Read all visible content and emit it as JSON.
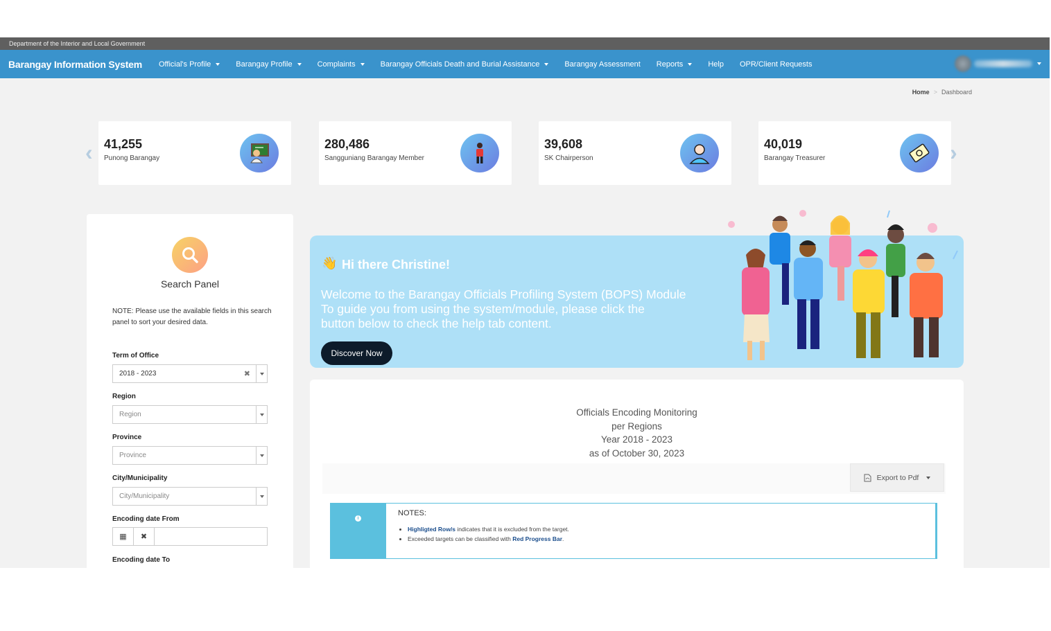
{
  "topstrip": {
    "text": "Department of the Interior and Local Government"
  },
  "nav": {
    "brand": "Barangay Information System",
    "items": [
      {
        "label": "Official's Profile",
        "dropdown": true
      },
      {
        "label": "Barangay Profile",
        "dropdown": true
      },
      {
        "label": "Complaints",
        "dropdown": true
      },
      {
        "label": "Barangay Officials Death and Burial Assistance",
        "dropdown": true
      },
      {
        "label": "Barangay Assessment",
        "dropdown": false
      },
      {
        "label": "Reports",
        "dropdown": true
      },
      {
        "label": "Help",
        "dropdown": false
      },
      {
        "label": "OPR/Client Requests",
        "dropdown": false
      }
    ]
  },
  "breadcrumb": {
    "home": "Home",
    "current": "Dashboard"
  },
  "stats": [
    {
      "value": "41,255",
      "label": "Punong Barangay",
      "icon": "teacher-icon"
    },
    {
      "value": "280,486",
      "label": "Sangguniang Barangay Member",
      "icon": "person-standing-icon"
    },
    {
      "value": "39,608",
      "label": "SK Chairperson",
      "icon": "user-icon"
    },
    {
      "value": "40,019",
      "label": "Barangay Treasurer",
      "icon": "money-icon"
    }
  ],
  "search": {
    "title": "Search Panel",
    "note": "NOTE: Please use the available fields in this search panel to sort your desired data.",
    "term_label": "Term of Office",
    "term_value": "2018 - 2023",
    "region_label": "Region",
    "region_placeholder": "Region",
    "province_label": "Province",
    "province_placeholder": "Province",
    "city_label": "City/Municipality",
    "city_placeholder": "City/Municipality",
    "date_from_label": "Encoding date From",
    "date_to_label": "Encoding date To"
  },
  "banner": {
    "greeting": "Hi there Christine!",
    "line1": "Welcome to the Barangay Officials Profiling System (BOPS) Module",
    "line2": "To guide you from using the system/module, please click the",
    "line3": "button below to check the help tab content.",
    "button": "Discover Now"
  },
  "monitoring": {
    "title1": "Officials Encoding Monitoring",
    "title2": "per Regions",
    "year": "Year 2018 - 2023",
    "asof": "as of October 30, 2023",
    "export_label": "Export to Pdf",
    "notes_head": "NOTES:",
    "note1_bold": "Highligted Row/s",
    "note1_rest": " indicates that it is excluded from the target.",
    "note2_rest": "Exceeded targets can be classified with ",
    "note2_bold": "Red Progress Bar",
    "note2_end": "."
  },
  "colors": {
    "navbar": "#3a93cc",
    "topstrip": "#5f5f5f",
    "banner": "#aee0f7",
    "info": "#5bc0de"
  }
}
